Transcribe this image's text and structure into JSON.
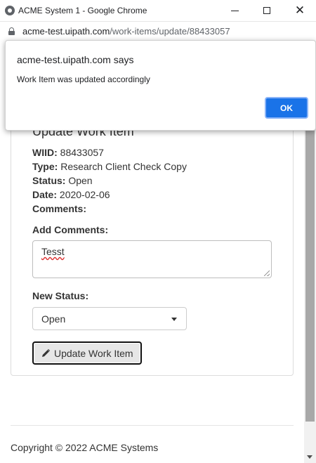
{
  "window": {
    "title": "ACME System 1 - Google Chrome"
  },
  "address": {
    "host": "acme-test.uipath.com",
    "path": "/work-items/update/88433057"
  },
  "card": {
    "title": "Update Work Item",
    "wiid_label": "WIID:",
    "wiid_value": "88433057",
    "type_label": "Type:",
    "type_value": "Research Client Check Copy",
    "status_label": "Status:",
    "status_value": "Open",
    "date_label": "Date:",
    "date_value": "2020-02-06",
    "comments_label": "Comments:",
    "add_comments_label": "Add Comments:",
    "add_comments_value": "Tesst",
    "new_status_label": "New Status:",
    "new_status_selected": "Open",
    "update_button": "Update Work Item"
  },
  "footer": {
    "copyright": "Copyright © 2022 ACME Systems"
  },
  "dialog": {
    "title": "acme-test.uipath.com says",
    "message": "Work Item was updated accordingly",
    "ok_label": "OK"
  },
  "colors": {
    "accent": "#1a73e8",
    "scroll_thumb": "#a8a8a8"
  }
}
